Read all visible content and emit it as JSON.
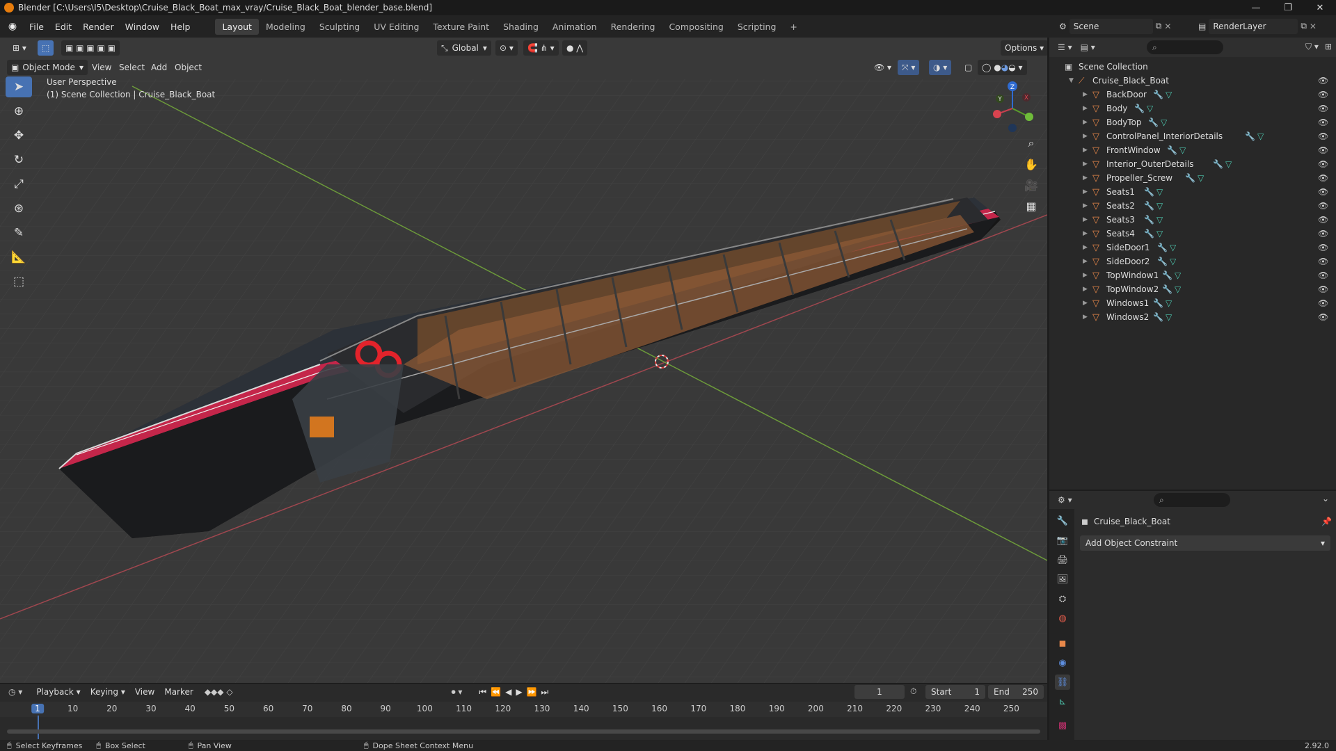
{
  "window": {
    "title": "Blender [C:\\Users\\I5\\Desktop\\Cruise_Black_Boat_max_vray/Cruise_Black_Boat_blender_base.blend]",
    "min": "—",
    "max": "❐",
    "close": "✕"
  },
  "menu": [
    "File",
    "Edit",
    "Render",
    "Window",
    "Help"
  ],
  "workspaces": [
    "Layout",
    "Modeling",
    "Sculpting",
    "UV Editing",
    "Texture Paint",
    "Shading",
    "Animation",
    "Rendering",
    "Compositing",
    "Scripting",
    "+"
  ],
  "scene": {
    "name": "Scene",
    "renderlayer": "RenderLayer"
  },
  "viewport": {
    "mode": "Object Mode",
    "menu": [
      "View",
      "Select",
      "Add",
      "Object"
    ],
    "orientation": "Global",
    "options": "Options",
    "overlay_title": "User Perspective",
    "overlay_sub": "(1) Scene Collection | Cruise_Black_Boat",
    "gizmo": {
      "z": "Z",
      "y": "Y",
      "x": "X"
    }
  },
  "outliner": {
    "root": "Scene Collection",
    "collection": "Cruise_Black_Boat",
    "objects": [
      "BackDoor",
      "Body",
      "BodyTop",
      "ControlPanel_InteriorDetails",
      "FrontWindow",
      "Interior_OuterDetails",
      "Propeller_Screw",
      "Seats1",
      "Seats2",
      "Seats3",
      "Seats4",
      "SideDoor1",
      "SideDoor2",
      "TopWindow1",
      "TopWindow2",
      "Windows1",
      "Windows2"
    ]
  },
  "properties": {
    "object": "Cruise_Black_Boat",
    "constraint_btn": "Add Object Constraint"
  },
  "timeline": {
    "menus": [
      "Playback",
      "Keying",
      "View",
      "Marker"
    ],
    "current_frame": "1",
    "start_label": "Start",
    "start": "1",
    "end_label": "End",
    "end": "250",
    "ticks": [
      "1",
      "10",
      "20",
      "30",
      "40",
      "50",
      "60",
      "70",
      "80",
      "90",
      "100",
      "110",
      "120",
      "130",
      "140",
      "150",
      "160",
      "170",
      "180",
      "190",
      "200",
      "210",
      "220",
      "230",
      "240",
      "250"
    ]
  },
  "statusbar": {
    "items": [
      "Select Keyframes",
      "Box Select",
      "Pan View",
      "Dope Sheet Context Menu"
    ],
    "version": "2.92.0"
  }
}
